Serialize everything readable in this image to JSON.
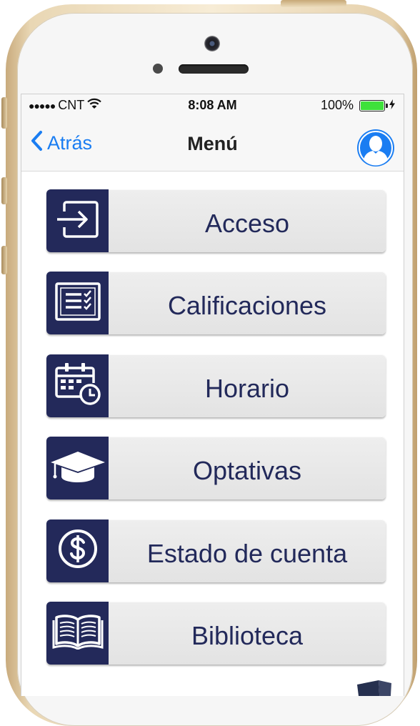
{
  "status_bar": {
    "signal": "●●●●●",
    "carrier": "CNT",
    "time": "8:08 AM",
    "battery_percent": "100%",
    "battery_level": 1.0,
    "battery_color": "#3ee13b"
  },
  "nav": {
    "back_label": "Atrás",
    "title": "Menú",
    "accent_color": "#1a7df2"
  },
  "menu": {
    "items": [
      {
        "label": "Acceso",
        "icon": "login-icon"
      },
      {
        "label": "Calificaciones",
        "icon": "checklist-icon"
      },
      {
        "label": "Horario",
        "icon": "calendar-clock-icon"
      },
      {
        "label": "Optativas",
        "icon": "graduation-cap-icon"
      },
      {
        "label": "Estado de cuenta",
        "icon": "dollar-coin-icon"
      },
      {
        "label": "Biblioteca",
        "icon": "open-book-icon"
      }
    ],
    "tile_color": "#23295a",
    "text_color": "#22295a"
  }
}
